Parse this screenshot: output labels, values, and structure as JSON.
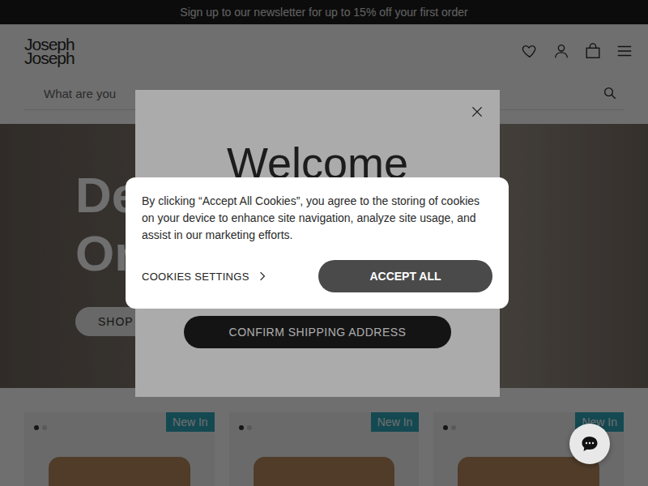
{
  "announcement": "Sign up to our newsletter for up to 15% off your first order",
  "header": {
    "logo": [
      "Joseph",
      "Joseph"
    ]
  },
  "search": {
    "placeholder": "What are you"
  },
  "hero": {
    "title_lines": [
      "De",
      "On"
    ],
    "button": "SHOP"
  },
  "products": [
    {
      "badge": "New In",
      "slides": [
        {
          "selected": true
        },
        {
          "selected": false
        }
      ]
    },
    {
      "badge": "New In",
      "slides": [
        {
          "selected": true
        },
        {
          "selected": false
        }
      ]
    },
    {
      "badge": "New In",
      "slides": [
        {
          "selected": true
        },
        {
          "selected": false
        }
      ]
    }
  ],
  "welcome_modal": {
    "title": "Welcome",
    "button": "CONFIRM SHIPPING ADDRESS"
  },
  "cookie_banner": {
    "text": "By clicking “Accept All Cookies”, you agree to the storing of cookies on your device to enhance site navigation, analyze site usage, and assist in our marketing efforts.",
    "settings": "COOKIES SETTINGS",
    "accept": "ACCEPT ALL"
  }
}
